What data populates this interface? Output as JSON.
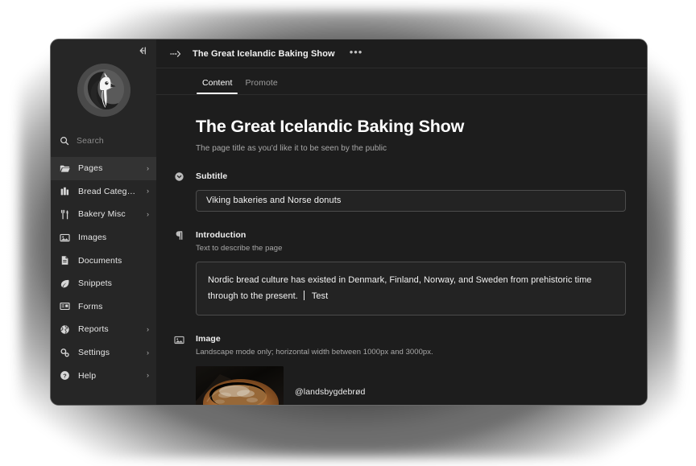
{
  "window": {
    "collapse_icon": "collapse-sidebar-icon"
  },
  "sidebar": {
    "logo_alt": "bird-logo",
    "search": {
      "placeholder": "Search",
      "icon": "search-icon"
    },
    "items": [
      {
        "label": "Pages",
        "icon": "folder-icon",
        "chevron": "›",
        "active": true
      },
      {
        "label": "Bread Categori…",
        "icon": "bread-icon",
        "chevron": "›",
        "active": false
      },
      {
        "label": "Bakery Misc",
        "icon": "cutlery-icon",
        "chevron": "›",
        "active": false
      },
      {
        "label": "Images",
        "icon": "image-icon",
        "chevron": "",
        "active": false
      },
      {
        "label": "Documents",
        "icon": "document-icon",
        "chevron": "",
        "active": false
      },
      {
        "label": "Snippets",
        "icon": "snippet-icon",
        "chevron": "",
        "active": false
      },
      {
        "label": "Forms",
        "icon": "form-icon",
        "chevron": "",
        "active": false
      },
      {
        "label": "Reports",
        "icon": "globe-icon",
        "chevron": "›",
        "active": false
      },
      {
        "label": "Settings",
        "icon": "cogs-icon",
        "chevron": "›",
        "active": false
      },
      {
        "label": "Help",
        "icon": "help-icon",
        "chevron": "›",
        "active": false
      }
    ]
  },
  "topbar": {
    "breadcrumb_icon": "breadcrumb-expand-icon",
    "title": "The Great Icelandic Baking Show",
    "more_label": "•••"
  },
  "tabs": [
    {
      "label": "Content",
      "active": true
    },
    {
      "label": "Promote",
      "active": false
    }
  ],
  "main": {
    "page_title": "The Great Icelandic Baking Show",
    "page_title_help": "The page title as you'd like it to be seen by the public",
    "subtitle": {
      "icon": "comment-chevron-icon",
      "label": "Subtitle",
      "value": "Viking bakeries and Norse donuts"
    },
    "introduction": {
      "icon": "pilcrow-icon",
      "label": "Introduction",
      "help": "Text to describe the page",
      "value_before_caret": "Nordic bread culture has existed in Denmark, Finland, Norway, and Sweden from prehistoric time through to the present.",
      "value_after_caret": "Test"
    },
    "image": {
      "icon": "picture-icon",
      "label": "Image",
      "help": "Landscape mode only; horizontal width between 1000px and 3000px.",
      "thumbnail_alt": "rustic-bread-loaf",
      "caption": "@landsbygdebrød"
    }
  },
  "colors": {
    "window_bg": "#1d1d1d",
    "sidebar_bg": "#262626",
    "sidebar_active": "#333333",
    "input_bg": "#232323",
    "input_border": "#4b4b4b",
    "text_primary": "#f2f2f2",
    "text_muted": "#a9a9a9",
    "page_bg": "#ffffff"
  }
}
